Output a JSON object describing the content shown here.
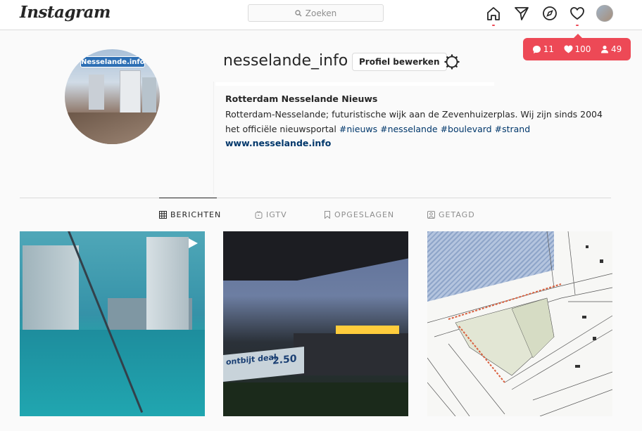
{
  "app": {
    "logo": "Instagram"
  },
  "search": {
    "placeholder": "Zoeken"
  },
  "notifications": {
    "comments": "11",
    "likes": "100",
    "followers": "49"
  },
  "profile": {
    "username": "nesselande_info",
    "edit_label": "Profiel bewerken",
    "pic_label": "Nesselande.info",
    "name": "Rotterdam Nesselande Nieuws",
    "bio": "Rotterdam-Nesselande; futuristische wijk aan de Zevenhuizerplas. Wij zijn sinds 2004 het officiële nieuwsportal",
    "hashtags": [
      "#nieuws",
      "#nesselande",
      "#boulevard",
      "#strand"
    ],
    "website": "www.nesselande.info"
  },
  "tabs": [
    {
      "label": "BERICHTEN",
      "icon": "grid-icon",
      "active": true
    },
    {
      "label": "IGTV",
      "icon": "igtv-icon",
      "active": false
    },
    {
      "label": "OPGESLAGEN",
      "icon": "bookmark-icon",
      "active": false
    },
    {
      "label": "GETAGD",
      "icon": "tagged-icon",
      "active": false
    }
  ],
  "posts": [
    {
      "kind": "video"
    },
    {
      "kind": "photo",
      "sign_text": "ontbijt deal",
      "sign_price": "2.50"
    },
    {
      "kind": "photo"
    }
  ],
  "colors": {
    "accent": "#ed4956",
    "link": "#00376b",
    "border": "#dbdbdb"
  }
}
